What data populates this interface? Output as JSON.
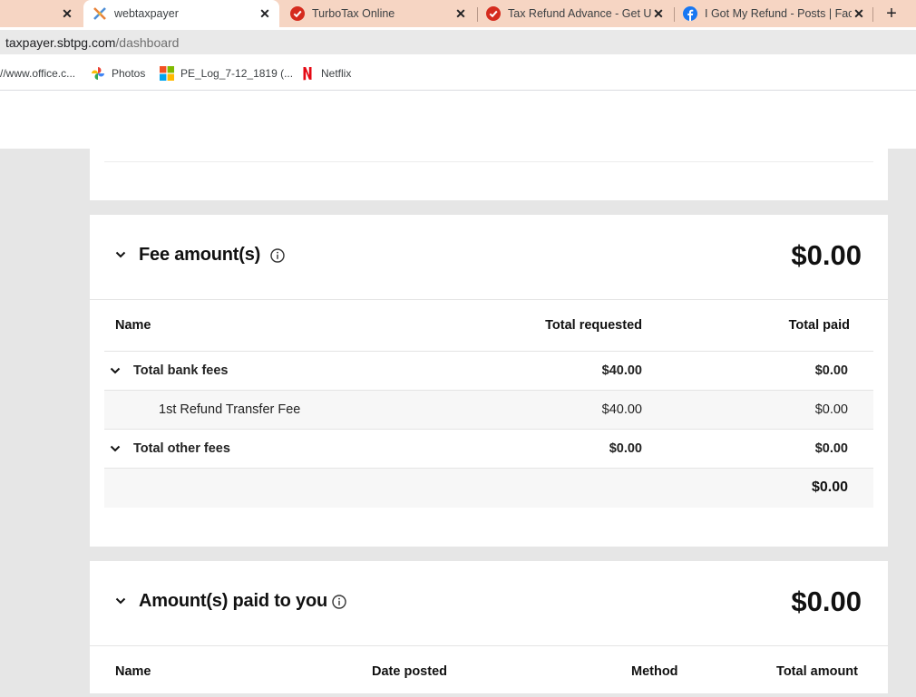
{
  "browser": {
    "tabs": [
      {
        "title": "",
        "favicon": "none",
        "active": false
      },
      {
        "title": "webtaxpayer",
        "favicon": "sbtpg-logo-icon",
        "active": true
      },
      {
        "title": "TurboTax Online",
        "favicon": "turbotax-check-icon",
        "active": false
      },
      {
        "title": "Tax Refund Advance - Get Up",
        "favicon": "turbotax-check-icon",
        "active": false
      },
      {
        "title": "I Got My Refund - Posts | Fac",
        "favicon": "facebook-icon",
        "active": false
      }
    ],
    "new_tab_label": "+",
    "close_label": "✕",
    "address": {
      "host": "taxpayer.sbtpg.com",
      "path": "/dashboard"
    },
    "bookmarks": [
      {
        "label": "//www.office.c...",
        "icon": "none"
      },
      {
        "label": "Photos",
        "icon": "google-photos-icon"
      },
      {
        "label": "PE_Log_7-12_1819 (...",
        "icon": "microsoft-icon"
      },
      {
        "label": "Netflix",
        "icon": "netflix-icon"
      }
    ]
  },
  "fees": {
    "title": "Fee amount(s)",
    "amount": "$0.00",
    "columns": {
      "name": "Name",
      "requested": "Total requested",
      "paid": "Total paid"
    },
    "rows": [
      {
        "name": "Total bank fees",
        "requested": "$40.00",
        "paid": "$0.00",
        "type": "group"
      },
      {
        "name": "1st Refund Transfer Fee",
        "requested": "$40.00",
        "paid": "$0.00",
        "type": "item"
      },
      {
        "name": "Total other fees",
        "requested": "$0.00",
        "paid": "$0.00",
        "type": "group"
      }
    ],
    "total_paid": "$0.00"
  },
  "paid_to_you": {
    "title": "Amount(s) paid to you",
    "amount": "$0.00",
    "columns": {
      "name": "Name",
      "date": "Date posted",
      "method": "Method",
      "total": "Total amount"
    }
  },
  "colors": {
    "tab_strip": "#f6d5c3",
    "page_bg": "#e6e6e6",
    "turbotax_red": "#d52b1e",
    "facebook_blue": "#1877f2"
  }
}
